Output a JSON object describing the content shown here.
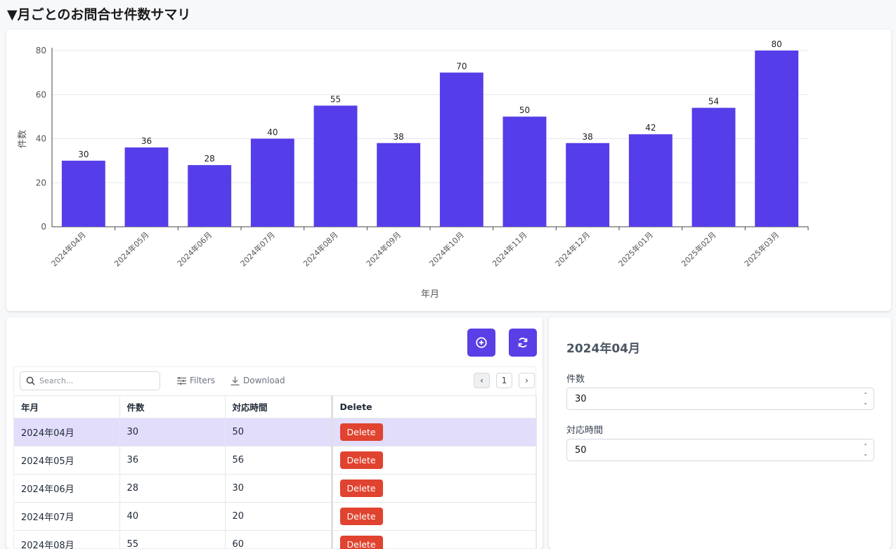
{
  "page": {
    "title": "▼月ごとのお問合せ件数サマリ"
  },
  "chart_data": {
    "type": "bar",
    "categories": [
      "2024年04月",
      "2024年05月",
      "2024年06月",
      "2024年07月",
      "2024年08月",
      "2024年09月",
      "2024年10月",
      "2024年11月",
      "2024年12月",
      "2025年01月",
      "2025年02月",
      "2025年03月"
    ],
    "values": [
      30,
      36,
      28,
      40,
      55,
      38,
      70,
      50,
      38,
      42,
      54,
      80
    ],
    "xlabel": "年月",
    "ylabel": "件数",
    "ylim": [
      0,
      80
    ],
    "yticks": [
      0,
      20,
      40,
      60,
      80
    ],
    "bar_color": "#553de9",
    "grid": true,
    "data_labels": true
  },
  "toolbar": {
    "search_placeholder": "Search...",
    "filters_label": "Filters",
    "download_label": "Download",
    "page_number": "1"
  },
  "table": {
    "columns": [
      "年月",
      "件数",
      "対応時間",
      "Delete"
    ],
    "delete_label": "Delete",
    "rows": [
      {
        "month": "2024年04月",
        "count": "30",
        "time": "50",
        "selected": true
      },
      {
        "month": "2024年05月",
        "count": "36",
        "time": "56",
        "selected": false
      },
      {
        "month": "2024年06月",
        "count": "28",
        "time": "30",
        "selected": false
      },
      {
        "month": "2024年07月",
        "count": "40",
        "time": "20",
        "selected": false
      },
      {
        "month": "2024年08月",
        "count": "55",
        "time": "60",
        "selected": false
      }
    ]
  },
  "form": {
    "title": "2024年04月",
    "count_label": "件数",
    "count_value": "30",
    "time_label": "対応時間",
    "time_value": "50"
  },
  "colors": {
    "accent": "#5a3fe6",
    "delete": "#e0432f",
    "selected_row": "#e2ddfb"
  }
}
